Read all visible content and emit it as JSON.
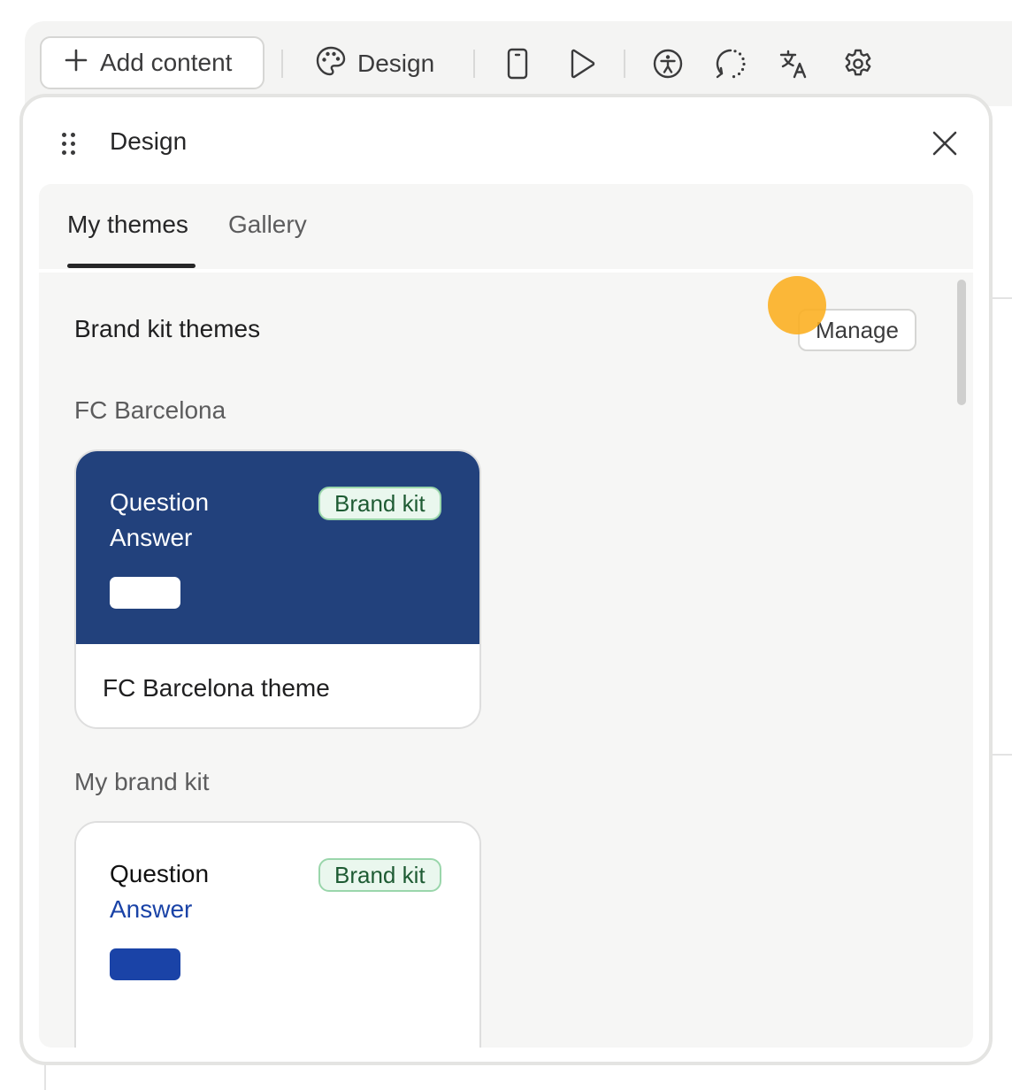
{
  "toolbar": {
    "add_content_label": "Add content",
    "design_label": "Design",
    "icons": [
      "plus-icon",
      "palette-icon",
      "mobile-preview-icon",
      "play-icon",
      "accessibility-icon",
      "loading-icon",
      "translate-icon",
      "settings-icon"
    ]
  },
  "panel": {
    "title": "Design",
    "tabs": [
      {
        "label": "My themes",
        "active": true
      },
      {
        "label": "Gallery",
        "active": false
      }
    ],
    "section_title": "Brand kit themes",
    "manage_label": "Manage",
    "groups": [
      {
        "label": "FC Barcelona",
        "card": {
          "question": "Question",
          "answer": "Answer",
          "badge": "Brand kit",
          "name": "FC Barcelona theme",
          "background": "#22417c",
          "text_color": "#ffffff",
          "answer_color": "#ffffff",
          "button_color": "#ffffff"
        }
      },
      {
        "label": "My brand kit",
        "card": {
          "question": "Question",
          "answer": "Answer",
          "badge": "Brand kit",
          "background": "#ffffff",
          "text_color": "#111111",
          "answer_color": "#1a43a7",
          "button_color": "#1a43a7"
        }
      }
    ]
  },
  "colors": {
    "accent_cursor": "#fcae1e",
    "badge_bg": "#eaf7ee",
    "badge_border": "#9ad6ab",
    "badge_text": "#1e5b33"
  }
}
